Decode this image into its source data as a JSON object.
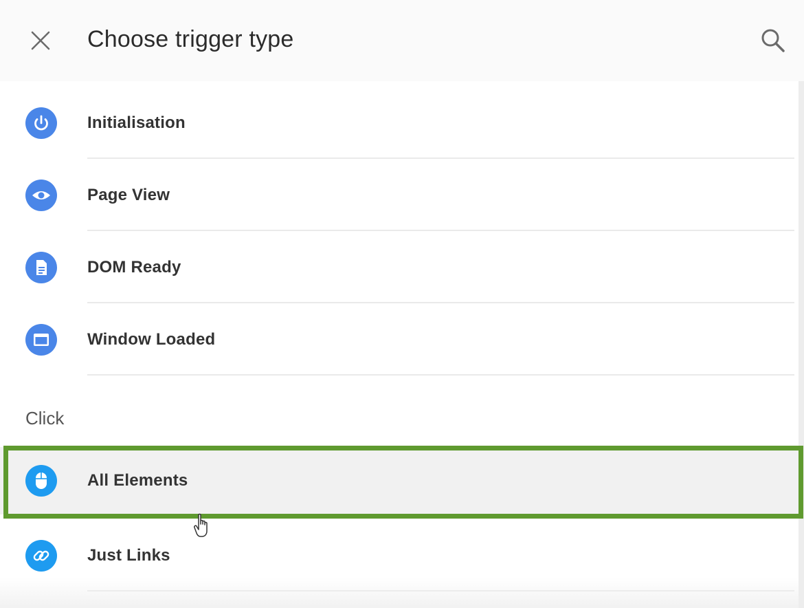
{
  "header": {
    "title": "Choose trigger type"
  },
  "sections": [
    {
      "items": [
        {
          "label": "Initialisation",
          "icon": "power-icon",
          "color": "#4285f4"
        },
        {
          "label": "Page View",
          "icon": "eye-icon",
          "color": "#4285f4"
        },
        {
          "label": "DOM Ready",
          "icon": "document-icon",
          "color": "#4285f4"
        },
        {
          "label": "Window Loaded",
          "icon": "window-icon",
          "color": "#4285f4"
        }
      ]
    },
    {
      "header": "Click",
      "items": [
        {
          "label": "All Elements",
          "icon": "mouse-icon",
          "color": "#2196f3"
        },
        {
          "label": "Just Links",
          "icon": "link-icon",
          "color": "#2196f3"
        }
      ]
    }
  ],
  "highlight": {
    "color": "#5f9a2f",
    "target": "All Elements"
  }
}
